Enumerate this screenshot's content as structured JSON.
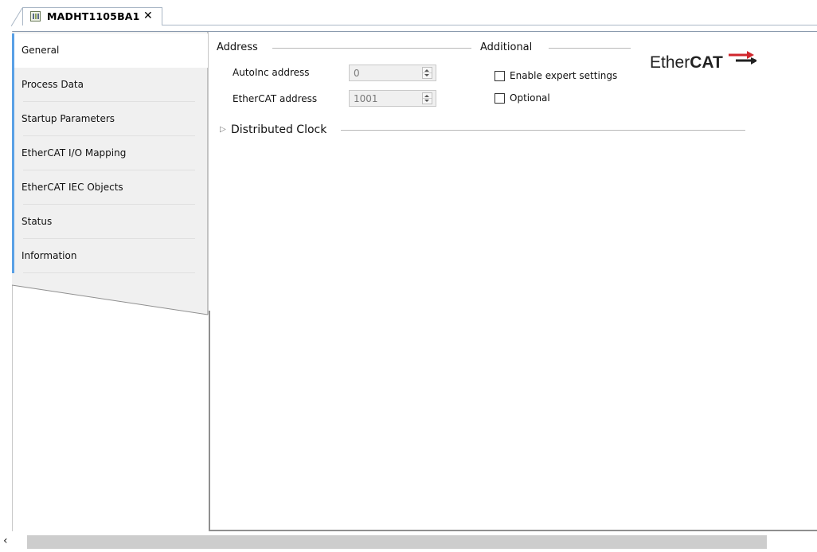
{
  "tab": {
    "title": "MADHT1105BA1",
    "close": "✕",
    "device_icon": "device-icon"
  },
  "sidebar": {
    "items": [
      {
        "label": "General",
        "active": true
      },
      {
        "label": "Process Data",
        "active": false
      },
      {
        "label": "Startup Parameters",
        "active": false
      },
      {
        "label": "EtherCAT I/O Mapping",
        "active": false
      },
      {
        "label": "EtherCAT IEC Objects",
        "active": false
      },
      {
        "label": "Status",
        "active": false
      },
      {
        "label": "Information",
        "active": false
      }
    ]
  },
  "address": {
    "title": "Address",
    "autoinc_label": "AutoInc address",
    "autoinc_value": "0",
    "ethercat_label": "EtherCAT address",
    "ethercat_value": "1001"
  },
  "additional": {
    "title": "Additional",
    "expert_label": "Enable expert settings",
    "expert_checked": false,
    "optional_label": "Optional",
    "optional_checked": false
  },
  "logo": {
    "prefix": "Ether",
    "suffix": "CAT",
    "accent": "#d0262c"
  },
  "distributed_clock": {
    "title": "Distributed Clock",
    "expand_icon": "▷"
  },
  "scrollbar": {
    "left_arrow": "‹"
  },
  "colors": {
    "sidebar_bar": "#59a0e6",
    "tab_border": "#aab7c6"
  }
}
